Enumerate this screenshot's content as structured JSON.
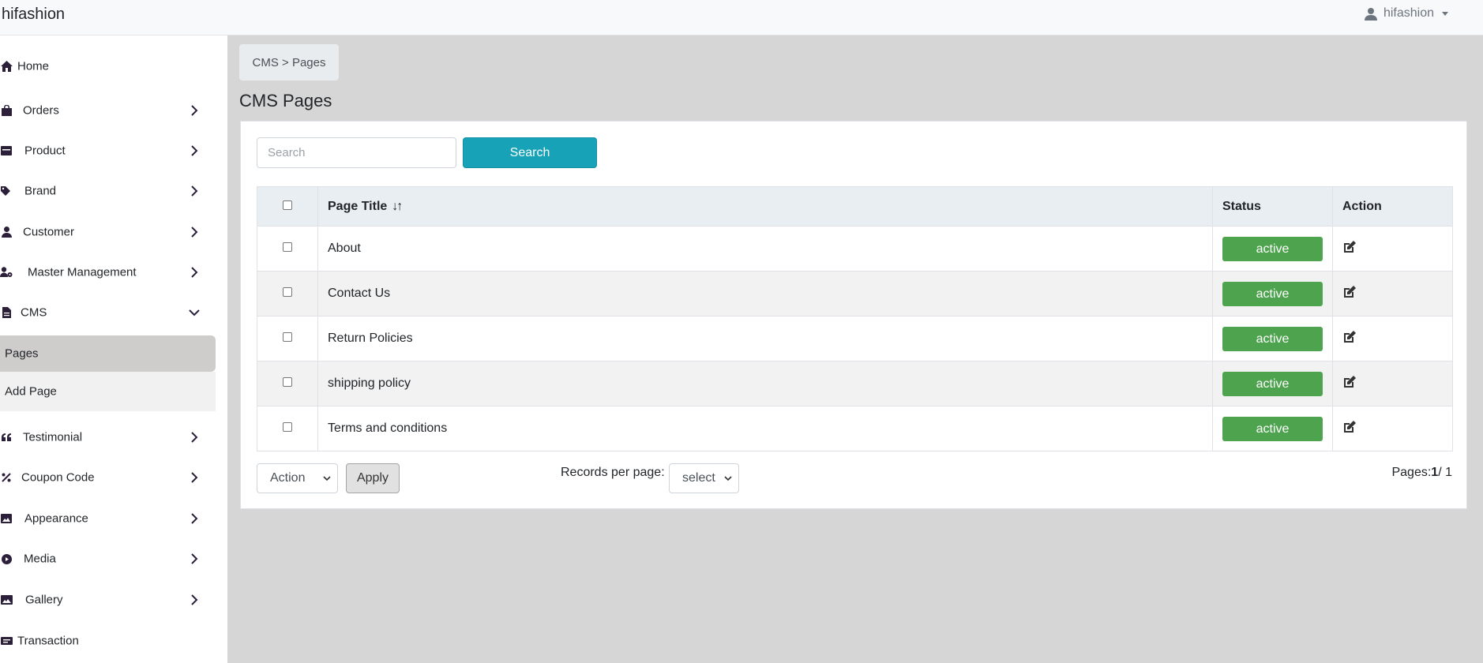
{
  "navbar": {
    "brand": "hifashion",
    "user": "hifashion"
  },
  "sidebar": {
    "items": [
      {
        "label": "Home",
        "icon": "home-icon"
      },
      {
        "label": "Orders",
        "icon": "shopping-bag-icon"
      },
      {
        "label": "Product",
        "icon": "product-box-icon"
      },
      {
        "label": "Brand",
        "icon": "tags-icon"
      },
      {
        "label": "Customer",
        "icon": "user-icon"
      },
      {
        "label": "Master Management",
        "icon": "user-gear-icon"
      },
      {
        "label": "CMS",
        "icon": "file-icon"
      },
      {
        "label": "Testimonial",
        "icon": "quote-icon"
      },
      {
        "label": "Coupon Code",
        "icon": "percent-icon"
      },
      {
        "label": "Appearance",
        "icon": "image-icon"
      },
      {
        "label": "Media",
        "icon": "play-circle-icon"
      },
      {
        "label": "Gallery",
        "icon": "images-icon"
      },
      {
        "label": "Transaction",
        "icon": "money-bill-icon"
      }
    ],
    "cms_submenu": [
      {
        "label": "Pages"
      },
      {
        "label": "Add Page"
      }
    ]
  },
  "breadcrumb": "CMS > Pages",
  "page_title": "CMS Pages",
  "search": {
    "placeholder": "Search",
    "button_label": "Search"
  },
  "table": {
    "headers": {
      "title": "Page Title",
      "status": "Status",
      "action": "Action"
    },
    "rows": [
      {
        "title": "About",
        "status": "active"
      },
      {
        "title": "Contact Us",
        "status": "active"
      },
      {
        "title": "Return Policies",
        "status": "active"
      },
      {
        "title": "shipping policy",
        "status": "active"
      },
      {
        "title": "Terms and conditions",
        "status": "active"
      }
    ]
  },
  "footer": {
    "action_select": "Action",
    "apply_label": "Apply",
    "rpp_label": "Records per page:",
    "rpp_select": "select",
    "pages_prefix": "Pages:",
    "current_page": "1",
    "total_pages": "/ 1"
  },
  "colors": {
    "status_active": "#4ea44e",
    "search_button": "#17a2b8",
    "content_bg": "#d6d6d6"
  }
}
